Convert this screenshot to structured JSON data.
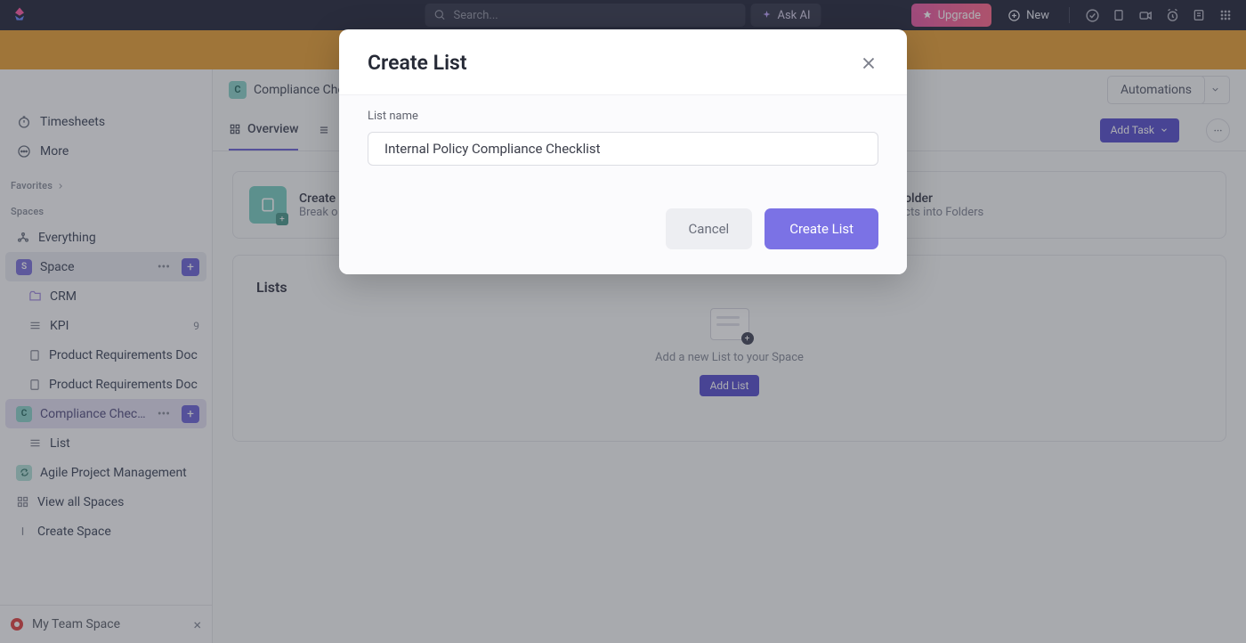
{
  "topbar": {
    "search_placeholder": "Search...",
    "askai": "Ask AI",
    "upgrade": "Upgrade",
    "new": "New"
  },
  "sidebar": {
    "timesheets": "Timesheets",
    "more": "More",
    "favorites": "Favorites",
    "spaces_label": "Spaces",
    "everything": "Everything",
    "space": "Space",
    "items": [
      {
        "label": "CRM"
      },
      {
        "label": "KPI",
        "count": "9"
      },
      {
        "label": "Product Requirements Doc"
      },
      {
        "label": "Product Requirements Doc"
      }
    ],
    "compliance": "Compliance Checkl...",
    "list": "List",
    "agile": "Agile Project Management",
    "view_all": "View all Spaces",
    "create_space": "Create Space",
    "team_space": "My Team Space"
  },
  "content": {
    "crumb_badge": "C",
    "crumb": "Compliance Che",
    "automations": "Automations",
    "tabs": {
      "overview": "Overview"
    },
    "add_task": "Add Task",
    "card1": {
      "title": "Create",
      "sub": "Break o"
    },
    "card2": {
      "title": "Create your first Folder",
      "sub": "Organize your projects into Folders"
    },
    "lists_title": "Lists",
    "empty_text": "Add a new List to your Space",
    "add_list": "Add List"
  },
  "modal": {
    "title": "Create List",
    "label": "List name",
    "value": "Internal Policy Compliance Checklist",
    "cancel": "Cancel",
    "submit": "Create List"
  }
}
